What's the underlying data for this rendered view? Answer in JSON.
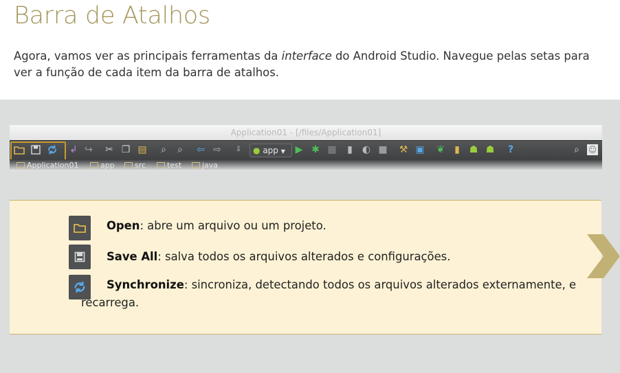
{
  "heading": "Barra de Atalhos",
  "intro": {
    "before": "Agora, vamos ver as principais ferramentas da ",
    "emphasis": "interface",
    "after": " do Android Studio. Navegue pelas setas para ver a função de cada item da barra de atalhos."
  },
  "android_studio": {
    "window_title": "Application01 - [/files/Application01]",
    "run_config": "app",
    "toolbar_icons": [
      "open-icon",
      "save-all-icon",
      "synchronize-icon",
      "undo-icon",
      "redo-icon",
      "cut-icon",
      "copy-icon",
      "paste-icon",
      "find-icon",
      "replace-icon",
      "back-icon",
      "forward-icon",
      "make-project-icon",
      "run-icon",
      "debug-icon",
      "coverage-icon",
      "attach-debugger-icon",
      "stop-icon",
      "project-structure-icon",
      "sdk-manager-icon",
      "avd-manager-icon",
      "android-monitor-icon",
      "sync-gradle-icon",
      "help-icon",
      "search-everywhere-icon"
    ],
    "breadcrumb": [
      "Application01",
      "app",
      "src",
      "test",
      "java"
    ]
  },
  "items": [
    {
      "name": "Open",
      "desc": ": abre um arquivo ou um projeto.",
      "icon": "folder-icon"
    },
    {
      "name": "Save All",
      "desc": ": salva todos os arquivos alterados e configurações.",
      "icon": "save-icon"
    },
    {
      "name": "Synchronize",
      "desc": ": sincroniza, detectando todos os arquivos alterados externamente, e recarrega.",
      "icon": "sync-icon"
    }
  ],
  "colors": {
    "title": "#a3955a",
    "panel_bg": "#fdf2d5",
    "highlight": "#c99a2e",
    "arrow": "#c2b174",
    "stage_bg": "#dcdedd"
  }
}
